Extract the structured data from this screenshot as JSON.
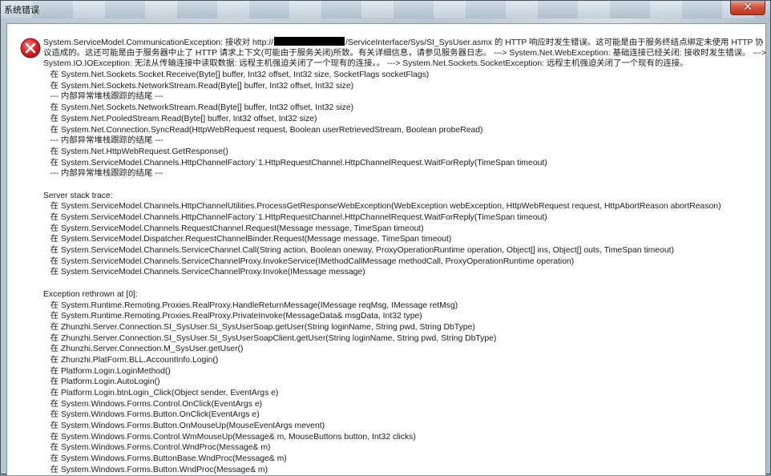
{
  "window": {
    "title": "系统错误",
    "close_glyph": "✕"
  },
  "icon": {
    "name": "error-icon",
    "color": "#d8282b"
  },
  "message": {
    "line1_prefix": "System.ServiceModel.CommunicationException: 接收对 http://",
    "line1_suffix": "/ServiceInterface/Sys/SI_SysUser.asmx 的 HTTP 响应时发生错误。这可能是由于服务终结点绑定未使用 HTTP 协",
    "line2": "议造成的。这还可能是由于服务器中止了 HTTP 请求上下文(可能由于服务关闭)所致。有关详细信息，请参见服务器日志。 ---> System.Net.WebException: 基础连接已经关闭: 接收时发生错误。 --->",
    "line3": "System.IO.IOException: 无法从传输连接中读取数据: 远程主机强迫关闭了一个现有的连接。。 ---> System.Net.Sockets.SocketException: 远程主机强迫关闭了一个现有的连接。",
    "trace1": [
      "   在 System.Net.Sockets.Socket.Receive(Byte[] buffer, Int32 offset, Int32 size, SocketFlags socketFlags)",
      "   在 System.Net.Sockets.NetworkStream.Read(Byte[] buffer, Int32 offset, Int32 size)",
      "   --- 内部异常堆栈跟踪的结尾 ---",
      "   在 System.Net.Sockets.NetworkStream.Read(Byte[] buffer, Int32 offset, Int32 size)",
      "   在 System.Net.PooledStream.Read(Byte[] buffer, Int32 offset, Int32 size)",
      "   在 System.Net.Connection.SyncRead(HttpWebRequest request, Boolean userRetrievedStream, Boolean probeRead)",
      "   --- 内部异常堆栈跟踪的结尾 ---",
      "   在 System.Net.HttpWebRequest.GetResponse()",
      "   在 System.ServiceModel.Channels.HttpChannelFactory`1.HttpRequestChannel.HttpChannelRequest.WaitForReply(TimeSpan timeout)",
      "   --- 内部异常堆栈跟踪的结尾 ---"
    ],
    "server_stack_header": "Server stack trace:",
    "trace2": [
      "   在 System.ServiceModel.Channels.HttpChannelUtilities.ProcessGetResponseWebException(WebException webException, HttpWebRequest request, HttpAbortReason abortReason)",
      "   在 System.ServiceModel.Channels.HttpChannelFactory`1.HttpRequestChannel.HttpChannelRequest.WaitForReply(TimeSpan timeout)",
      "   在 System.ServiceModel.Channels.RequestChannel.Request(Message message, TimeSpan timeout)",
      "   在 System.ServiceModel.Dispatcher.RequestChannelBinder.Request(Message message, TimeSpan timeout)",
      "   在 System.ServiceModel.Channels.ServiceChannel.Call(String action, Boolean oneway, ProxyOperationRuntime operation, Object[] ins, Object[] outs, TimeSpan timeout)",
      "   在 System.ServiceModel.Channels.ServiceChannelProxy.InvokeService(IMethodCallMessage methodCall, ProxyOperationRuntime operation)",
      "   在 System.ServiceModel.Channels.ServiceChannelProxy.Invoke(IMessage message)"
    ],
    "rethrown_header": "Exception rethrown at [0]:",
    "trace3": [
      "   在 System.Runtime.Remoting.Proxies.RealProxy.HandleReturnMessage(IMessage reqMsg, IMessage retMsg)",
      "   在 System.Runtime.Remoting.Proxies.RealProxy.PrivateInvoke(MessageData& msgData, Int32 type)",
      "   在 Zhunzhi.Server.Connection.SI_SysUser.SI_SysUserSoap.getUser(String loginName, String pwd, String DbType)",
      "   在 Zhunzhi.Server.Connection.SI_SysUser.SI_SysUserSoapClient.getUser(String loginName, String pwd, String DbType)",
      "   在 Zhunzhi.Server.Connection.M_SysUser.getUser()",
      "   在 Zhunzhi.PlatForm.BLL.AccountInfo.Login()",
      "   在 Platform.Login.LoginMethod()",
      "   在 Platform.Login.AutoLogin()",
      "   在 Platform.Login.btnLogin_Click(Object sender, EventArgs e)",
      "   在 System.Windows.Forms.Control.OnClick(EventArgs e)",
      "   在 System.Windows.Forms.Button.OnClick(EventArgs e)",
      "   在 System.Windows.Forms.Button.OnMouseUp(MouseEventArgs mevent)",
      "   在 System.Windows.Forms.Control.WmMouseUp(Message& m, MouseButtons button, Int32 clicks)",
      "   在 System.Windows.Forms.Control.WndProc(Message& m)",
      "   在 System.Windows.Forms.ButtonBase.WndProc(Message& m)",
      "   在 System.Windows.Forms.Button.WndProc(Message& m)"
    ]
  }
}
